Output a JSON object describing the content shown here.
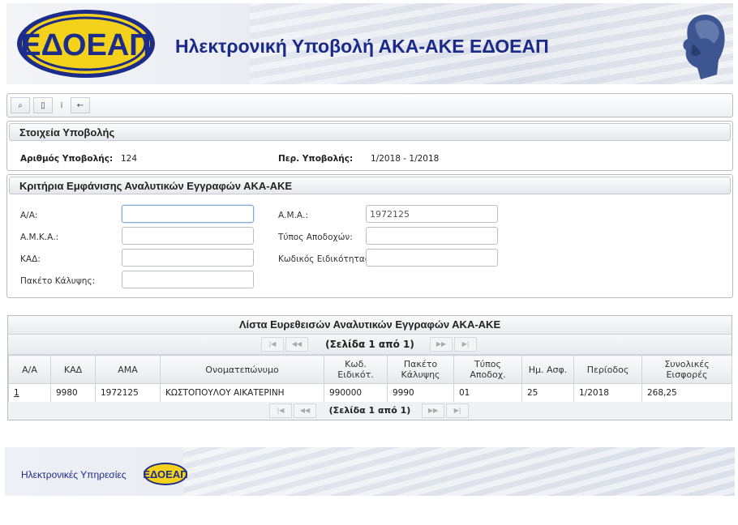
{
  "header": {
    "logo_text": "ΕΔΟΕΑΠ",
    "title": "Ηλεκτρονική Υποβολή ΑΚΑ-ΑΚΕ ΕΔΟΕΑΠ",
    "logo_colors": {
      "fill": "#f4d21c",
      "border": "#1b2c8a",
      "text": "#1b2c8a"
    }
  },
  "toolbar": {
    "buttons": [
      {
        "name": "search",
        "icon": "search-icon",
        "glyph": "⌕"
      },
      {
        "name": "new",
        "icon": "document-icon",
        "glyph": "▯"
      },
      {
        "name": "separator",
        "icon": "grip-icon",
        "glyph": "⁞"
      },
      {
        "name": "back",
        "icon": "back-arrow-icon",
        "glyph": "←"
      }
    ]
  },
  "submission": {
    "heading": "Στοιχεία Υποβολής",
    "number_label": "Αριθμός Υποβολής:",
    "number_value": "124",
    "period_label": "Περ. Υποβολής:",
    "period_value": "1/2018 - 1/2018"
  },
  "criteria": {
    "heading": "Κριτήρια Εμφάνισης Αναλυτικών Εγγραφών ΑΚΑ-ΑΚΕ",
    "aa_label": "Α/Α:",
    "aa_value": "",
    "ama_label": "Α.Μ.Α.:",
    "ama_value": "1972125",
    "amka_label": "Α.Μ.Κ.Α.:",
    "amka_value": "",
    "earnings_type_label": "Τύπος Αποδοχών:",
    "earnings_type_value": "",
    "kad_label": "ΚΑΔ:",
    "kad_value": "",
    "specialty_label": "Κωδικός Ειδικότητας:",
    "specialty_value": "",
    "package_label": "Πακέτο Κάλυψης:",
    "package_value": ""
  },
  "grid": {
    "title": "Λίστα Ευρεθεισών Αναλυτικών Εγγραφών ΑΚΑ-ΑΚΕ",
    "page_text": "(Σελίδα 1 από 1)",
    "pager_glyphs": {
      "first": "|◀",
      "prev": "◀◀",
      "next": "▶▶",
      "last": "▶|"
    },
    "columns": [
      "Α/Α",
      "ΚΑΔ",
      "ΑΜΑ",
      "Ονοματεπώνυμο",
      "Κωδ. Ειδικότ.",
      "Πακέτο Κάλυψης",
      "Τύπος Αποδοχ.",
      "Ημ. Ασφ.",
      "Περίοδος",
      "Συνολικές Εισφορές"
    ],
    "rows": [
      [
        "1",
        "9980",
        "1972125",
        "ΚΩΣΤΟΠΟΥΛΟΥ ΑΙΚΑΤΕΡΙΝΗ",
        "990000",
        "9990",
        "01",
        "25",
        "1/2018",
        "268,25"
      ]
    ]
  },
  "footer": {
    "text": "Ηλεκτρονικές Υπηρεσίες",
    "logo_text": "ΕΔΟΕΑΠ"
  }
}
